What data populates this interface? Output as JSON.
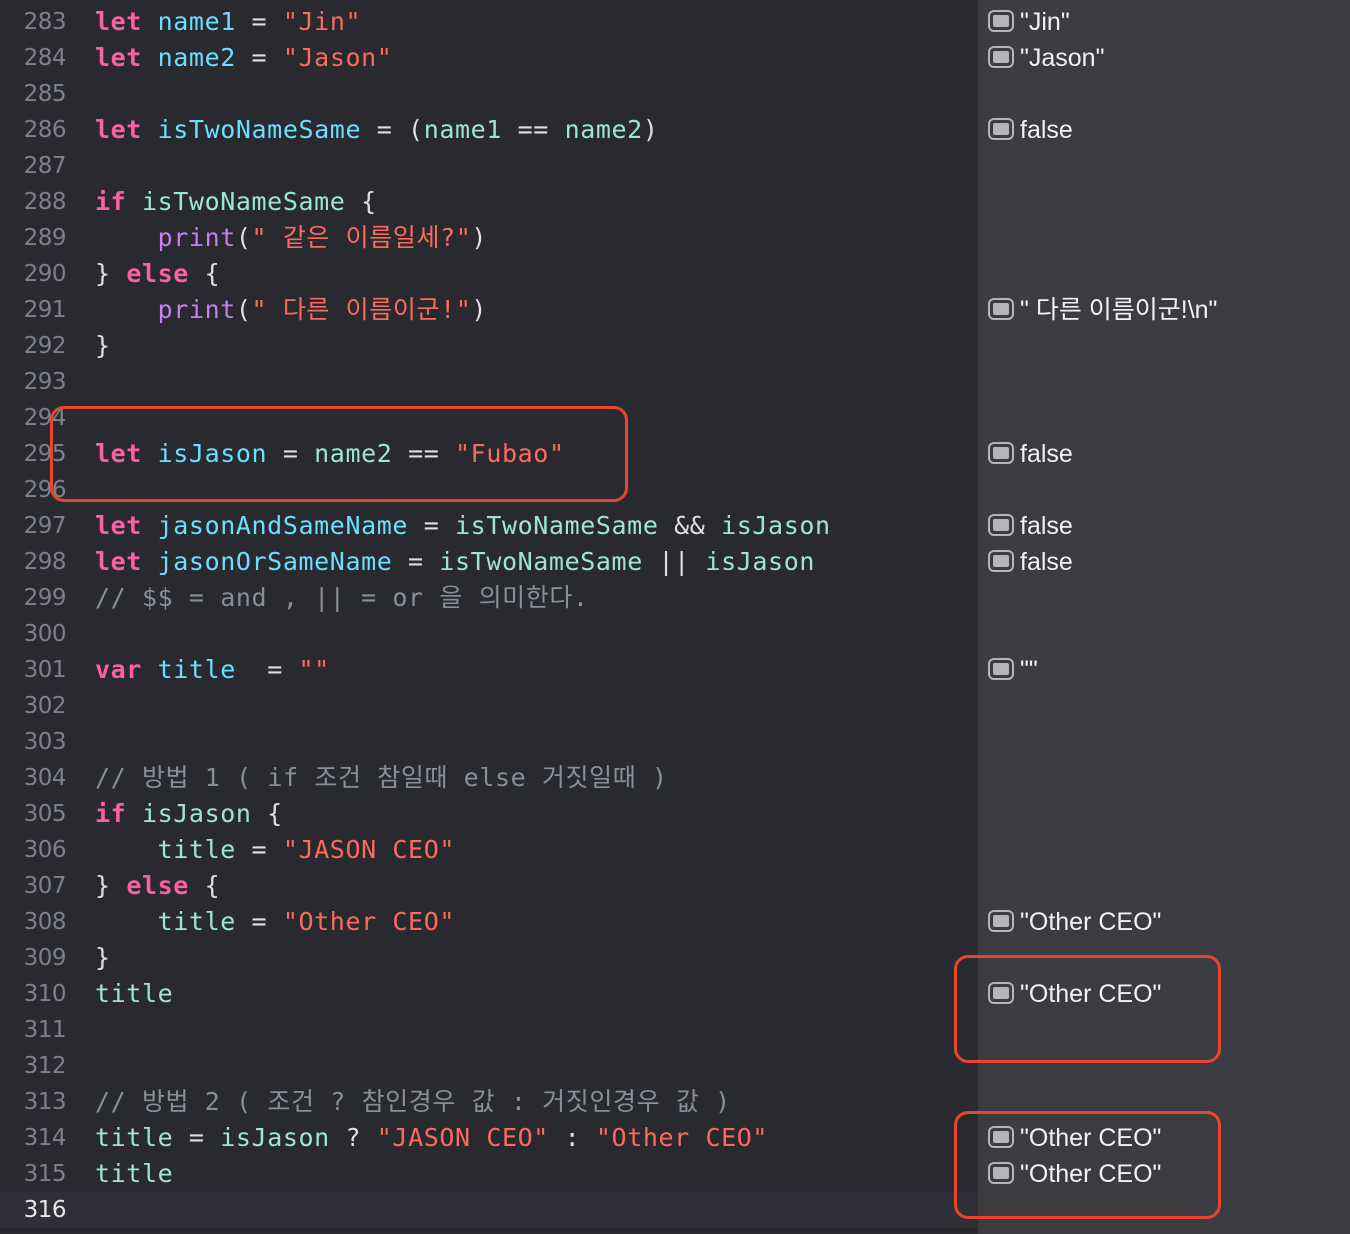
{
  "editor": {
    "lines": [
      {
        "num": "283",
        "tokens": [
          {
            "t": "let",
            "c": "kw"
          },
          {
            "t": " "
          },
          {
            "t": "name1",
            "c": "id"
          },
          {
            "t": " = "
          },
          {
            "t": "\"Jin\"",
            "c": "str"
          }
        ]
      },
      {
        "num": "284",
        "tokens": [
          {
            "t": "let",
            "c": "kw"
          },
          {
            "t": " "
          },
          {
            "t": "name2",
            "c": "id"
          },
          {
            "t": " = "
          },
          {
            "t": "\"Jason\"",
            "c": "str"
          }
        ]
      },
      {
        "num": "285",
        "tokens": []
      },
      {
        "num": "286",
        "tokens": [
          {
            "t": "let",
            "c": "kw"
          },
          {
            "t": " "
          },
          {
            "t": "isTwoNameSame",
            "c": "id"
          },
          {
            "t": " = ("
          },
          {
            "t": "name1",
            "c": "ref"
          },
          {
            "t": " == "
          },
          {
            "t": "name2",
            "c": "ref"
          },
          {
            "t": ")"
          }
        ]
      },
      {
        "num": "287",
        "tokens": []
      },
      {
        "num": "288",
        "tokens": [
          {
            "t": "if",
            "c": "kw"
          },
          {
            "t": " "
          },
          {
            "t": "isTwoNameSame",
            "c": "ref"
          },
          {
            "t": " {"
          }
        ]
      },
      {
        "num": "289",
        "tokens": [
          {
            "t": "    "
          },
          {
            "t": "print",
            "c": "fn"
          },
          {
            "t": "("
          },
          {
            "t": "\" 같은 이름일세?\"",
            "c": "str"
          },
          {
            "t": ")"
          }
        ]
      },
      {
        "num": "290",
        "tokens": [
          {
            "t": "} "
          },
          {
            "t": "else",
            "c": "kw"
          },
          {
            "t": " {"
          }
        ]
      },
      {
        "num": "291",
        "tokens": [
          {
            "t": "    "
          },
          {
            "t": "print",
            "c": "fn"
          },
          {
            "t": "("
          },
          {
            "t": "\" 다른 이름이군!\"",
            "c": "str"
          },
          {
            "t": ")"
          }
        ]
      },
      {
        "num": "292",
        "tokens": [
          {
            "t": "}"
          }
        ]
      },
      {
        "num": "293",
        "tokens": []
      },
      {
        "num": "294",
        "tokens": []
      },
      {
        "num": "295",
        "tokens": [
          {
            "t": "let",
            "c": "kw"
          },
          {
            "t": " "
          },
          {
            "t": "isJason",
            "c": "id"
          },
          {
            "t": " = "
          },
          {
            "t": "name2",
            "c": "ref"
          },
          {
            "t": " == "
          },
          {
            "t": "\"Fubao\"",
            "c": "str"
          }
        ]
      },
      {
        "num": "296",
        "tokens": []
      },
      {
        "num": "297",
        "tokens": [
          {
            "t": "let",
            "c": "kw"
          },
          {
            "t": " "
          },
          {
            "t": "jasonAndSameName",
            "c": "id"
          },
          {
            "t": " = "
          },
          {
            "t": "isTwoNameSame",
            "c": "ref"
          },
          {
            "t": " && "
          },
          {
            "t": "isJason",
            "c": "ref"
          }
        ]
      },
      {
        "num": "298",
        "tokens": [
          {
            "t": "let",
            "c": "kw"
          },
          {
            "t": " "
          },
          {
            "t": "jasonOrSameName",
            "c": "id"
          },
          {
            "t": " = "
          },
          {
            "t": "isTwoNameSame",
            "c": "ref"
          },
          {
            "t": " || "
          },
          {
            "t": "isJason",
            "c": "ref"
          }
        ]
      },
      {
        "num": "299",
        "tokens": [
          {
            "t": "// $$ = and , || = or 을 의미한다.",
            "c": "cm"
          }
        ]
      },
      {
        "num": "300",
        "tokens": []
      },
      {
        "num": "301",
        "tokens": [
          {
            "t": "var",
            "c": "kw"
          },
          {
            "t": " "
          },
          {
            "t": "title",
            "c": "id"
          },
          {
            "t": "  = "
          },
          {
            "t": "\"\"",
            "c": "str"
          }
        ]
      },
      {
        "num": "302",
        "tokens": []
      },
      {
        "num": "303",
        "tokens": []
      },
      {
        "num": "304",
        "tokens": [
          {
            "t": "// 방법 1 ( if 조건 참일때 else 거짓일때 )",
            "c": "cm"
          }
        ]
      },
      {
        "num": "305",
        "tokens": [
          {
            "t": "if",
            "c": "kw"
          },
          {
            "t": " "
          },
          {
            "t": "isJason",
            "c": "ref"
          },
          {
            "t": " {"
          }
        ]
      },
      {
        "num": "306",
        "tokens": [
          {
            "t": "    "
          },
          {
            "t": "title",
            "c": "ref"
          },
          {
            "t": " = "
          },
          {
            "t": "\"JASON CEO\"",
            "c": "str"
          }
        ]
      },
      {
        "num": "307",
        "tokens": [
          {
            "t": "} "
          },
          {
            "t": "else",
            "c": "kw"
          },
          {
            "t": " {"
          }
        ]
      },
      {
        "num": "308",
        "tokens": [
          {
            "t": "    "
          },
          {
            "t": "title",
            "c": "ref"
          },
          {
            "t": " = "
          },
          {
            "t": "\"Other CEO\"",
            "c": "str"
          }
        ]
      },
      {
        "num": "309",
        "tokens": [
          {
            "t": "}"
          }
        ]
      },
      {
        "num": "310",
        "tokens": [
          {
            "t": "title",
            "c": "ref"
          }
        ]
      },
      {
        "num": "311",
        "tokens": []
      },
      {
        "num": "312",
        "tokens": []
      },
      {
        "num": "313",
        "tokens": [
          {
            "t": "// 방법 2 ( 조건 ? 참인경우 값 : 거짓인경우 값 )",
            "c": "cm"
          }
        ]
      },
      {
        "num": "314",
        "tokens": [
          {
            "t": "title",
            "c": "ref"
          },
          {
            "t": " = "
          },
          {
            "t": "isJason",
            "c": "ref"
          },
          {
            "t": " ? "
          },
          {
            "t": "\"JASON CEO\"",
            "c": "str"
          },
          {
            "t": " : "
          },
          {
            "t": "\"Other CEO\"",
            "c": "str"
          }
        ]
      },
      {
        "num": "315",
        "tokens": [
          {
            "t": "title",
            "c": "ref"
          }
        ]
      },
      {
        "num": "316",
        "tokens": [],
        "current": true
      }
    ]
  },
  "results": [
    {
      "line": "283",
      "value": "\"Jin\""
    },
    {
      "line": "284",
      "value": "\"Jason\""
    },
    {
      "line": "286",
      "value": "false"
    },
    {
      "line": "291",
      "value": "\" 다른 이름이군!\\n\""
    },
    {
      "line": "295",
      "value": "false"
    },
    {
      "line": "297",
      "value": "false"
    },
    {
      "line": "298",
      "value": "false"
    },
    {
      "line": "301",
      "value": "\"\""
    },
    {
      "line": "308",
      "value": "\"Other CEO\""
    },
    {
      "line": "310",
      "value": "\"Other CEO\""
    },
    {
      "line": "314",
      "value": "\"Other CEO\""
    },
    {
      "line": "315",
      "value": "\"Other CEO\""
    }
  ],
  "colors": {
    "keyword": "#fc5fa3",
    "identifier": "#6bdfff",
    "reference": "#9ee6d2",
    "string": "#fc6a5d",
    "function": "#c77ef0",
    "comment": "#8b8e94",
    "highlight_box": "#e8452c"
  },
  "icons": {
    "result_toggle": "quick-look-icon"
  },
  "highlights": [
    {
      "name": "highlight-isjason-line",
      "lines": [
        "294",
        "295",
        "296"
      ]
    },
    {
      "name": "highlight-title-result",
      "lines": [
        "310"
      ]
    },
    {
      "name": "highlight-ternary-results",
      "lines": [
        "314",
        "315"
      ]
    }
  ]
}
